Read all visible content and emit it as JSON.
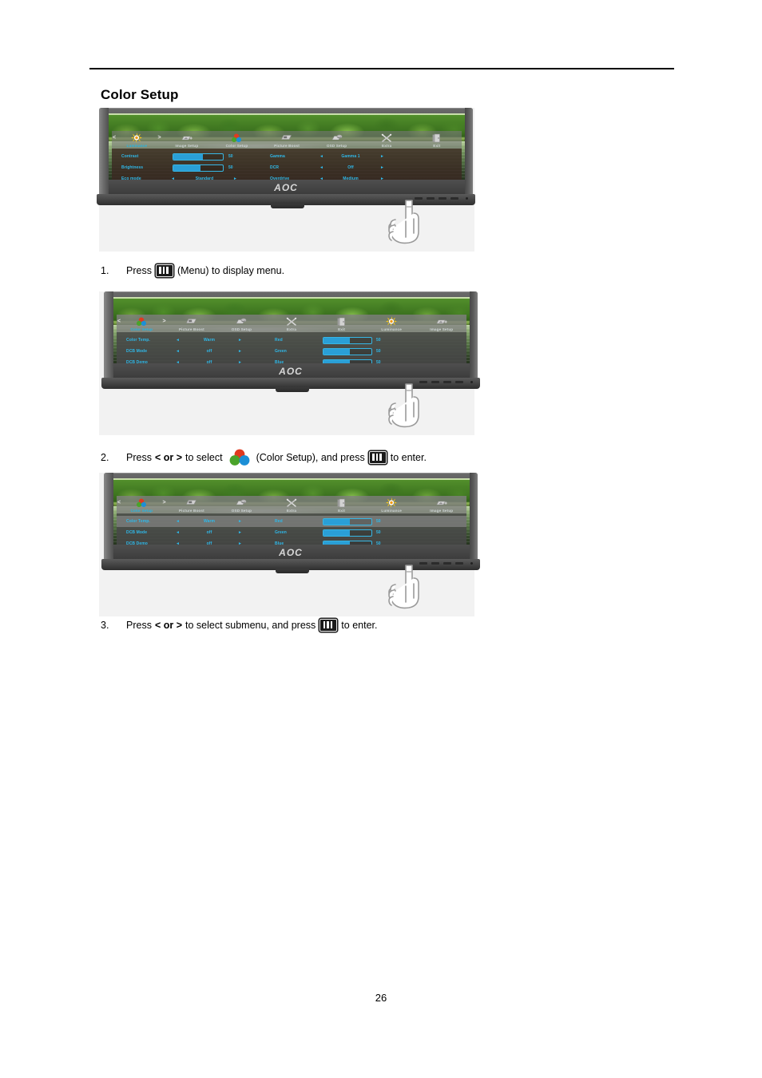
{
  "document": {
    "page_title": "Color Setup",
    "page_number": "26"
  },
  "figures": [
    {
      "id": "figure-luminance-menu",
      "brand_logo": "AOC",
      "osd": {
        "nav_arrow_left": "<",
        "nav_arrow_right": ">",
        "tabs": [
          {
            "label": "Luminance",
            "icon": "sun-icon",
            "active": true
          },
          {
            "label": "Image Setup",
            "icon": "image-setup-icon",
            "active": false
          },
          {
            "label": "Color Setup",
            "icon": "color-circles-icon",
            "active": false
          },
          {
            "label": "Picture Boost",
            "icon": "picture-boost-icon",
            "active": false
          },
          {
            "label": "OSD Setup",
            "icon": "osd-setup-icon",
            "active": false
          },
          {
            "label": "Extra",
            "icon": "tools-icon",
            "active": false
          },
          {
            "label": "Exit",
            "icon": "exit-door-icon",
            "active": false
          }
        ],
        "rows": [
          {
            "name": "Contrast",
            "type": "slider",
            "fill": 60,
            "value": "50",
            "name2": "Gamma",
            "type2": "option",
            "value2": "Gamma 1",
            "selected": false
          },
          {
            "name": "Brightness",
            "type": "slider",
            "fill": 55,
            "value": "50",
            "name2": "DCR",
            "type2": "option",
            "value2": "Off",
            "selected": false
          },
          {
            "name": "Eco mode",
            "type": "option",
            "value": "Standard",
            "name2": "Overdrive",
            "type2": "option",
            "value2": "Medium",
            "selected": false
          }
        ]
      }
    },
    {
      "id": "figure-color-setup-menu",
      "brand_logo": "AOC",
      "osd": {
        "nav_arrow_left": "<",
        "nav_arrow_right": ">",
        "tabs": [
          {
            "label": "Color Setup",
            "icon": "color-circles-icon",
            "active": true
          },
          {
            "label": "Picture Boost",
            "icon": "picture-boost-icon",
            "active": false
          },
          {
            "label": "OSD Setup",
            "icon": "osd-setup-icon",
            "active": false
          },
          {
            "label": "Extra",
            "icon": "tools-icon",
            "active": false
          },
          {
            "label": "Exit",
            "icon": "exit-door-icon",
            "active": false
          },
          {
            "label": "Luminance",
            "icon": "sun-icon",
            "active": false
          },
          {
            "label": "Image Setup",
            "icon": "image-setup-icon",
            "active": false
          }
        ],
        "rows": [
          {
            "name": "Color Temp.",
            "type": "option",
            "value": "Warm",
            "name2": "Red",
            "type2": "slider",
            "fill2": 55,
            "value2": "50",
            "selected": false
          },
          {
            "name": "DCB Mode",
            "type": "option",
            "value": "off",
            "name2": "Green",
            "type2": "slider",
            "fill2": 55,
            "value2": "50",
            "selected": false
          },
          {
            "name": "DCB Demo",
            "type": "option",
            "value": "off",
            "name2": "Blue",
            "type2": "slider",
            "fill2": 55,
            "value2": "50",
            "selected": false
          }
        ]
      }
    },
    {
      "id": "figure-color-temp-submenu",
      "brand_logo": "AOC",
      "osd": {
        "nav_arrow_left": "<",
        "nav_arrow_right": ">",
        "tabs": [
          {
            "label": "Color Setup",
            "icon": "color-circles-icon",
            "active": true
          },
          {
            "label": "Picture Boost",
            "icon": "picture-boost-icon",
            "active": false
          },
          {
            "label": "OSD Setup",
            "icon": "osd-setup-icon",
            "active": false
          },
          {
            "label": "Extra",
            "icon": "tools-icon",
            "active": false
          },
          {
            "label": "Exit",
            "icon": "exit-door-icon",
            "active": false
          },
          {
            "label": "Luminance",
            "icon": "sun-icon",
            "active": false
          },
          {
            "label": "Image Setup",
            "icon": "image-setup-icon",
            "active": false
          }
        ],
        "rows": [
          {
            "name": "Color Temp.",
            "type": "option",
            "value": "Warm",
            "name2": "Red",
            "type2": "slider",
            "fill2": 55,
            "value2": "50",
            "selected": true
          },
          {
            "name": "DCB Mode",
            "type": "option",
            "value": "off",
            "name2": "Green",
            "type2": "slider",
            "fill2": 55,
            "value2": "50",
            "selected": false
          },
          {
            "name": "DCB Demo",
            "type": "option",
            "value": "off",
            "name2": "Blue",
            "type2": "slider",
            "fill2": 55,
            "value2": "50",
            "selected": false
          }
        ]
      }
    }
  ],
  "steps": [
    {
      "number": "1.",
      "part1": "Press",
      "icon1": "menu-button-icon",
      "part2": "(Menu) to display menu.",
      "bold": "",
      "part3": "",
      "icon2": "",
      "part4": ""
    },
    {
      "number": "2.",
      "part1": "Press",
      "bold": "< or >",
      "part2": "to select",
      "icon1": "color-circles-icon",
      "part3": "(Color Setup), and press",
      "icon2": "menu-button-icon",
      "part4": "to enter."
    },
    {
      "number": "3.",
      "part1": "Press",
      "bold": "< or >",
      "part2": "to select submenu, and press",
      "icon2": "menu-button-icon",
      "part4": "to enter."
    }
  ],
  "colors": {
    "osd_accent": "#2fb9ea",
    "osd_slider_fill": "#2a9fd6",
    "icon_red": "#e03a1f",
    "icon_green": "#4aa32a",
    "icon_blue": "#1c8fd6"
  }
}
